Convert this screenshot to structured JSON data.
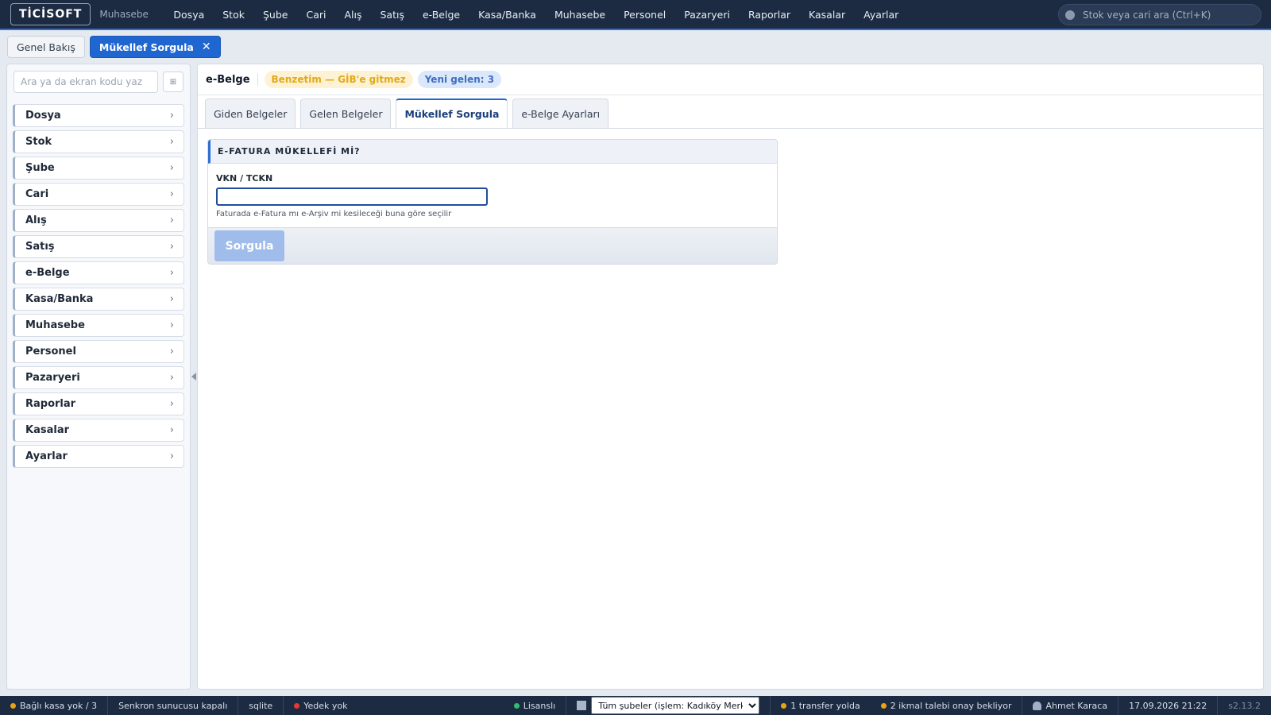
{
  "app": {
    "logo": "TİCİSOFT",
    "module": "Muhasebe"
  },
  "topmenu": [
    "Dosya",
    "Stok",
    "Şube",
    "Cari",
    "Alış",
    "Satış",
    "e-Belge",
    "Kasa/Banka",
    "Muhasebe",
    "Personel",
    "Pazaryeri",
    "Raporlar",
    "Kasalar",
    "Ayarlar"
  ],
  "topsearch": {
    "placeholder": "Stok veya cari ara (Ctrl+K)"
  },
  "open_tabs": [
    {
      "label": "Genel Bakış",
      "active": false
    },
    {
      "label": "Mükellef Sorgula",
      "active": true,
      "close": "✕"
    }
  ],
  "sidebar": {
    "search_placeholder": "Ara ya da ekran kodu yaz",
    "grid_button": "⊞",
    "items": [
      "Dosya",
      "Stok",
      "Şube",
      "Cari",
      "Alış",
      "Satış",
      "e-Belge",
      "Kasa/Banka",
      "Muhasebe",
      "Personel",
      "Pazaryeri",
      "Raporlar",
      "Kasalar",
      "Ayarlar"
    ],
    "chevron": "›"
  },
  "main": {
    "title": "e-Belge",
    "badges": {
      "simulation": "Benzetim — GİB'e gitmez",
      "incoming": "Yeni gelen: 3"
    },
    "tabs": [
      {
        "label": "Giden Belgeler",
        "active": false
      },
      {
        "label": "Gelen Belgeler",
        "active": false
      },
      {
        "label": "Mükellef Sorgula",
        "active": true
      },
      {
        "label": "e-Belge Ayarları",
        "active": false
      }
    ],
    "card": {
      "header": "E-FATURA MÜKELLEFİ Mİ?",
      "field_label": "VKN / TCKN",
      "field_value": "",
      "hint": "Faturada e-Fatura mı e-Arşiv mi kesileceği buna göre seçilir",
      "button": "Sorgula"
    }
  },
  "statusbar": {
    "cash_link": "Bağlı kasa yok / 3",
    "sync": "Senkron sunucusu kapalı",
    "db": "sqlite",
    "backup": "Yedek yok",
    "license": "Lisanslı",
    "branch_selected": "Tüm şubeler (işlem: Kadıköy Merkez)",
    "transfer": "1 transfer yolda",
    "requests": "2 ikmal talebi onay bekliyor",
    "user": "Ahmet Karaca",
    "datetime": "17.09.2026 21:22",
    "version": "s2.13.2"
  },
  "colors": {
    "topbar_bg": "#1c2b42",
    "accent": "#1f66d1",
    "warn_dot": "#e8a317",
    "error_dot": "#e53935",
    "ok_dot": "#2fbf71"
  }
}
